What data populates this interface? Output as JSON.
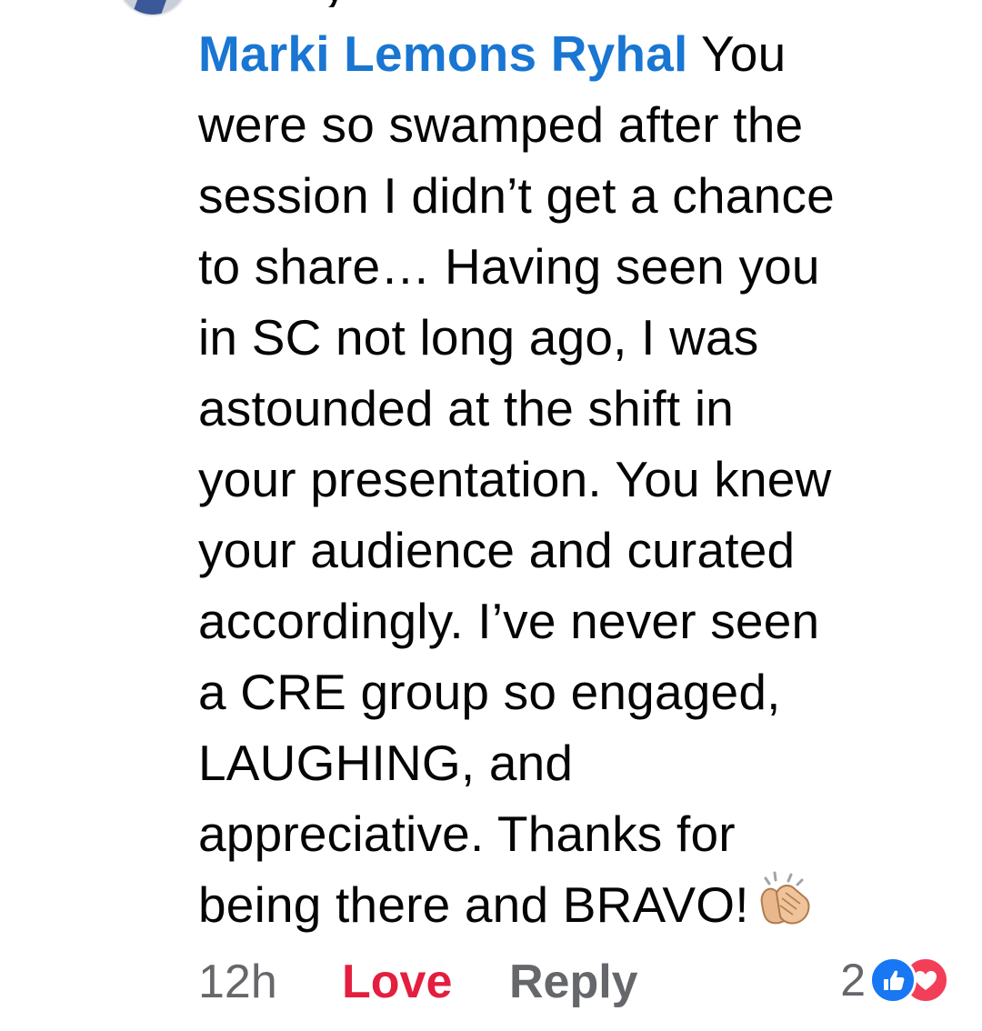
{
  "header": {
    "cropped_name_fragment": "y"
  },
  "comment": {
    "author": "Marki Lemons Ryhal",
    "first_line_text": " You",
    "lines": [
      "were so swamped after the",
      "session I didn’t get a chance",
      "to share… Having seen you",
      "in SC not long ago, I was",
      "astounded at the shift in",
      "your presentation. You knew",
      "your audience and curated",
      "accordingly. I’ve never seen",
      "a CRE group so engaged,",
      "LAUGHING, and",
      "appreciative. Thanks for"
    ],
    "last_line": "being there and BRAVO!",
    "emoji_icon": "clapping-hands-icon"
  },
  "actions": {
    "time": "12h",
    "love_label": "Love",
    "reply_label": "Reply"
  },
  "reactions": {
    "count": "2",
    "icons": [
      "like-icon",
      "love-icon"
    ]
  },
  "colors": {
    "author": "#1976d2",
    "love": "#e41e3f",
    "secondary_text": "#65676b",
    "like_blue": "#1877f2",
    "love_red": "#f33e58",
    "clap_skin": "#e8b88c"
  }
}
